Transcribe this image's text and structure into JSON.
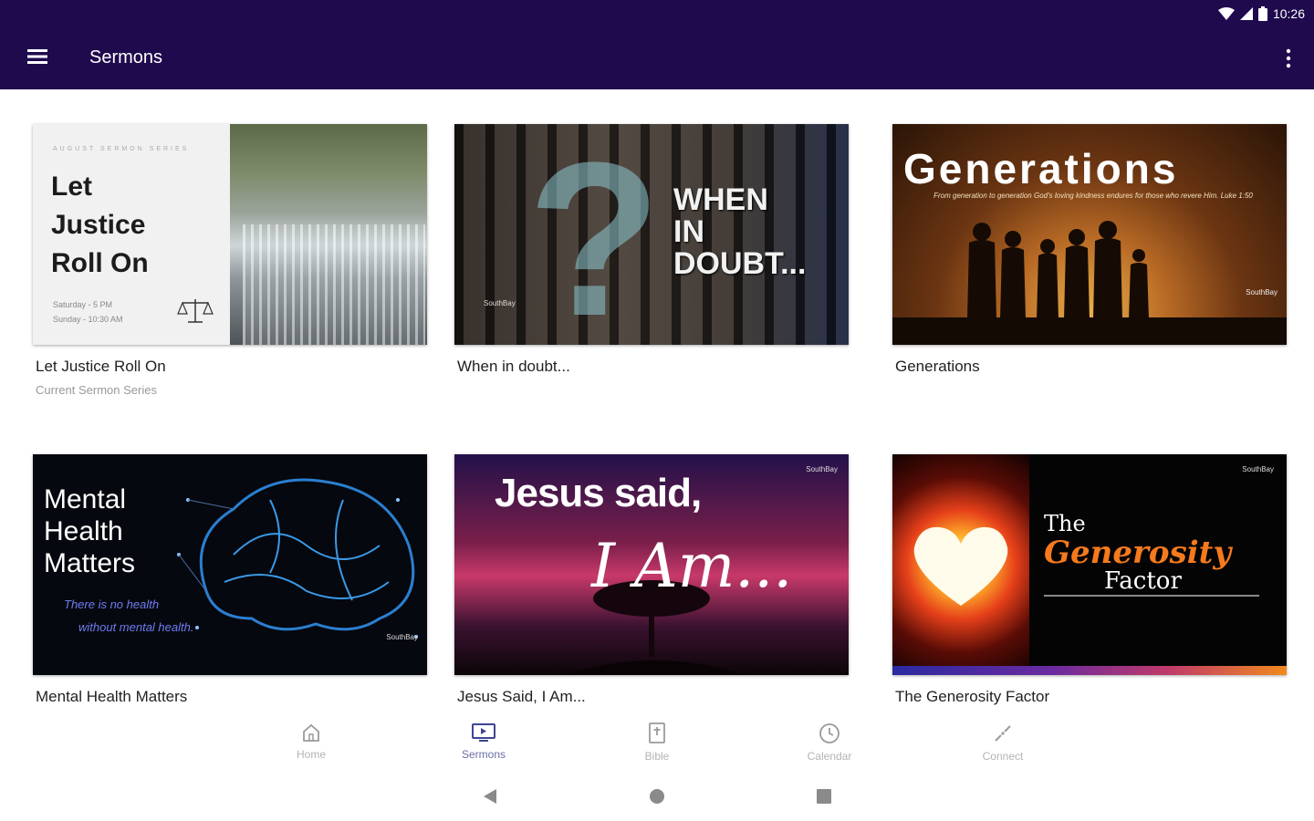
{
  "status_bar": {
    "time": "10:26",
    "icons": [
      "wifi-icon",
      "signal-icon",
      "battery-icon"
    ]
  },
  "app_bar": {
    "title": "Sermons",
    "menu_icon": "hamburger-icon",
    "more_icon": "more-vert-icon",
    "background": "#1f0a4e"
  },
  "sermons": [
    {
      "title": "Let Justice Roll On",
      "subtitle": "Current Sermon Series",
      "art": {
        "series_label": "AUGUST SERMON SERIES",
        "title_lines": [
          "Let",
          "Justice",
          "Roll On"
        ],
        "times": [
          "Saturday - 5 PM",
          "Sunday - 10:30 AM"
        ]
      }
    },
    {
      "title": "When in doubt...",
      "art": {
        "lines": [
          "WHEN",
          "IN",
          "DOUBT..."
        ],
        "glyph": "?",
        "logo": "SouthBay"
      }
    },
    {
      "title": "Generations",
      "art": {
        "heading": "Generations",
        "verse": "From generation to generation God's loving kindness endures for those who revere Him. Luke 1:50",
        "logo": "SouthBay"
      }
    },
    {
      "title": "Mental Health Matters",
      "subtitle": "",
      "art": {
        "title_lines": [
          "Mental",
          "Health",
          "Matters"
        ],
        "sub_lines": [
          "There is no health",
          "without mental health."
        ],
        "logo": "SouthBay"
      }
    },
    {
      "title": "Jesus Said, I Am...",
      "art": {
        "heading": "Jesus said,",
        "script": "I Am...",
        "logo": "SouthBay"
      }
    },
    {
      "title": "The Generosity Factor",
      "art": {
        "the": "The",
        "generosity": "Generosity",
        "factor": "Factor",
        "logo": "SouthBay"
      }
    }
  ],
  "bottom_nav": [
    {
      "label": "Home",
      "icon": "home-icon",
      "active": false
    },
    {
      "label": "Sermons",
      "icon": "tv-icon",
      "active": true
    },
    {
      "label": "Bible",
      "icon": "bible-icon",
      "active": false
    },
    {
      "label": "Calendar",
      "icon": "clock-icon",
      "active": false
    },
    {
      "label": "Connect",
      "icon": "connect-icon",
      "active": false
    }
  ],
  "system_nav": [
    "back-icon",
    "home-circle-icon",
    "recents-icon"
  ]
}
